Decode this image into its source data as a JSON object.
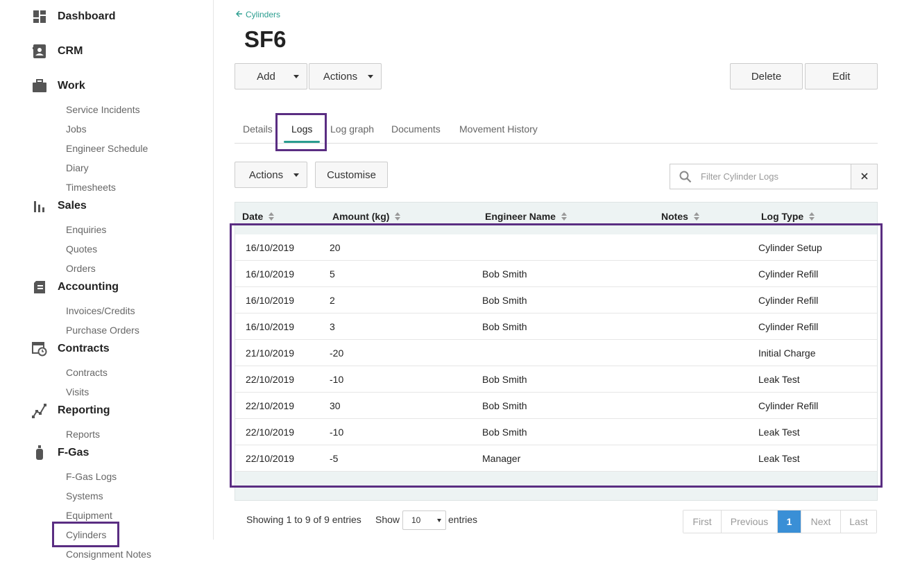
{
  "sidebar": {
    "sections": [
      {
        "label": "Dashboard",
        "icon": "dashboard-icon",
        "items": []
      },
      {
        "label": "CRM",
        "icon": "contact-card-icon",
        "items": []
      },
      {
        "label": "Work",
        "icon": "briefcase-icon",
        "items": [
          "Service Incidents",
          "Jobs",
          "Engineer Schedule",
          "Diary",
          "Timesheets"
        ]
      },
      {
        "label": "Sales",
        "icon": "bar-chart-icon",
        "items": [
          "Enquiries",
          "Quotes",
          "Orders"
        ]
      },
      {
        "label": "Accounting",
        "icon": "ledger-icon",
        "items": [
          "Invoices/Credits",
          "Purchase Orders"
        ]
      },
      {
        "label": "Contracts",
        "icon": "calendar-clock-icon",
        "items": [
          "Contracts",
          "Visits"
        ]
      },
      {
        "label": "Reporting",
        "icon": "line-graph-icon",
        "items": [
          "Reports"
        ]
      },
      {
        "label": "F-Gas",
        "icon": "gas-cylinder-icon",
        "items": [
          "F-Gas Logs",
          "Systems",
          "Equipment",
          "Cylinders",
          "Consignment Notes"
        ]
      }
    ]
  },
  "breadcrumb": {
    "back_label": "Cylinders"
  },
  "page": {
    "title": "SF6"
  },
  "toolbar": {
    "add": "Add",
    "actions": "Actions",
    "delete": "Delete",
    "edit": "Edit"
  },
  "tabs": [
    "Details",
    "Logs",
    "Log graph",
    "Documents",
    "Movement History"
  ],
  "active_tab": "Logs",
  "grid_toolbar": {
    "actions": "Actions",
    "customise": "Customise",
    "filter_placeholder": "Filter Cylinder Logs"
  },
  "table": {
    "columns": [
      "Date",
      "Amount (kg)",
      "Engineer Name",
      "Notes",
      "Log Type"
    ],
    "rows": [
      [
        "16/10/2019",
        "20",
        "",
        "",
        "Cylinder Setup"
      ],
      [
        "16/10/2019",
        "5",
        "Bob Smith",
        "",
        "Cylinder Refill"
      ],
      [
        "16/10/2019",
        "2",
        "Bob Smith",
        "",
        "Cylinder Refill"
      ],
      [
        "16/10/2019",
        "3",
        "Bob Smith",
        "",
        "Cylinder Refill"
      ],
      [
        "21/10/2019",
        "-20",
        "",
        "",
        "Initial Charge"
      ],
      [
        "22/10/2019",
        "-10",
        "Bob Smith",
        "",
        "Leak Test"
      ],
      [
        "22/10/2019",
        "30",
        "Bob Smith",
        "",
        "Cylinder Refill"
      ],
      [
        "22/10/2019",
        "-10",
        "Bob Smith",
        "",
        "Leak Test"
      ],
      [
        "22/10/2019",
        "-5",
        "Manager",
        "",
        "Leak Test"
      ]
    ]
  },
  "footer": {
    "info": "Showing 1 to 9 of 9 entries",
    "show_label": "Show",
    "page_size": "10",
    "entries_label": "entries",
    "pager": {
      "first": "First",
      "previous": "Previous",
      "current": "1",
      "next": "Next",
      "last": "Last"
    }
  },
  "colors": {
    "accent": "#2a9d8f",
    "highlight": "#5a2d82",
    "pager_active": "#3a8fd6"
  }
}
